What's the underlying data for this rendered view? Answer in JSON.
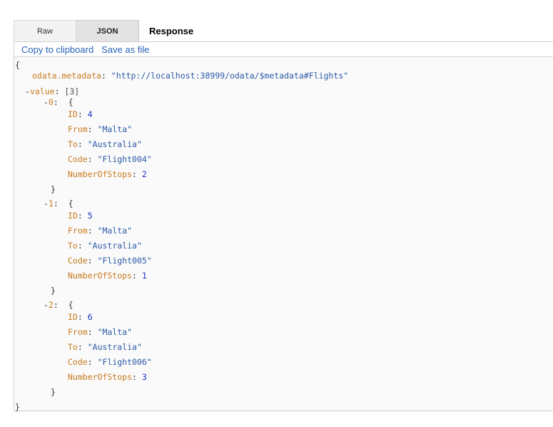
{
  "tabs": {
    "raw": "Raw",
    "json": "JSON",
    "response": "Response"
  },
  "actions": {
    "copy": "Copy to clipboard",
    "save": "Save as file"
  },
  "json": {
    "open_brace": "{",
    "close_brace": "}",
    "metadata_key": "odata.metadata",
    "metadata_value": "\"http://localhost:38999/odata/$metadata#Flights\"",
    "value_toggle": "-",
    "value_key": "value",
    "value_count": "[3]",
    "items": [
      {
        "toggle": "-",
        "index": "0",
        "id_key": "ID",
        "id": "4",
        "from_key": "From",
        "from": "\"Malta\"",
        "to_key": "To",
        "to": "\"Australia\"",
        "code_key": "Code",
        "code": "\"Flight004\"",
        "stops_key": "NumberOfStops",
        "stops": "2"
      },
      {
        "toggle": "-",
        "index": "1",
        "id_key": "ID",
        "id": "5",
        "from_key": "From",
        "from": "\"Malta\"",
        "to_key": "To",
        "to": "\"Australia\"",
        "code_key": "Code",
        "code": "\"Flight005\"",
        "stops_key": "NumberOfStops",
        "stops": "1"
      },
      {
        "toggle": "-",
        "index": "2",
        "id_key": "ID",
        "id": "6",
        "from_key": "From",
        "from": "\"Malta\"",
        "to_key": "To",
        "to": "\"Australia\"",
        "code_key": "Code",
        "code": "\"Flight006\"",
        "stops_key": "NumberOfStops",
        "stops": "3"
      }
    ]
  }
}
